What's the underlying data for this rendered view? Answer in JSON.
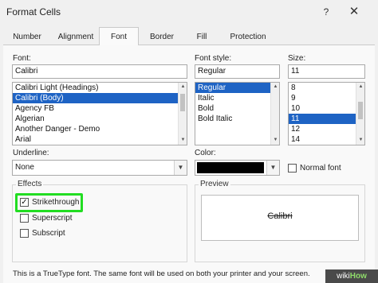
{
  "window": {
    "title": "Format Cells",
    "help_label": "?",
    "close_label": "✕"
  },
  "tabs": [
    {
      "label": "Number"
    },
    {
      "label": "Alignment"
    },
    {
      "label": "Font",
      "active": true
    },
    {
      "label": "Border"
    },
    {
      "label": "Fill"
    },
    {
      "label": "Protection"
    }
  ],
  "font": {
    "label": "Font:",
    "value": "Calibri",
    "list": [
      "Calibri Light (Headings)",
      "Calibri (Body)",
      "Agency FB",
      "Algerian",
      "Another Danger - Demo",
      "Arial"
    ],
    "selected": "Calibri (Body)"
  },
  "font_style": {
    "label": "Font style:",
    "value": "Regular",
    "list": [
      "Regular",
      "Italic",
      "Bold",
      "Bold Italic"
    ],
    "selected": "Regular"
  },
  "size": {
    "label": "Size:",
    "value": "11",
    "list": [
      "8",
      "9",
      "10",
      "11",
      "12",
      "14"
    ],
    "selected": "11"
  },
  "underline": {
    "label": "Underline:",
    "value": "None"
  },
  "color": {
    "label": "Color:",
    "swatch": "#000000",
    "normal_font_label": "Normal font",
    "normal_font_checked": false
  },
  "effects": {
    "title": "Effects",
    "strikethrough": {
      "label": "Strikethrough",
      "checked": true
    },
    "superscript": {
      "label": "Superscript",
      "checked": false
    },
    "subscript": {
      "label": "Subscript",
      "checked": false
    }
  },
  "preview": {
    "title": "Preview",
    "sample": "Calibri"
  },
  "footer_text": "This is a TrueType font.  The same font will be used on both your printer and your screen.",
  "watermark": {
    "prefix": "wiki",
    "suffix": "How"
  },
  "colors": {
    "selection": "#1e63c4",
    "highlight_box": "#22dd22"
  }
}
